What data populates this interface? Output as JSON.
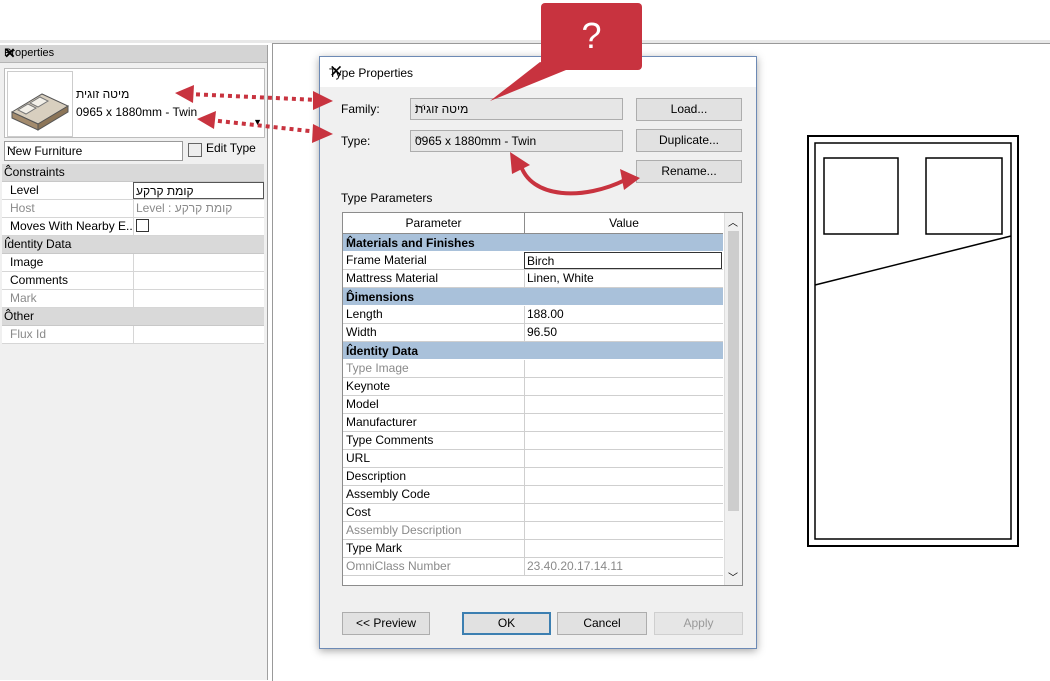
{
  "properties": {
    "title": "Properties",
    "family_name": "מיטה זוגית",
    "type_name": "0965 x 1880mm - Twin",
    "category": "New Furniture",
    "edit_type": "Edit Type",
    "groups": [
      {
        "name": "Constraints",
        "rows": [
          {
            "key": "Level",
            "value": "קומת קרקע",
            "editable": true
          },
          {
            "key": "Host",
            "value": "Level : קומת קרקע",
            "disabled": true
          },
          {
            "key": "Moves With Nearby E...",
            "value": "",
            "checkbox": true
          }
        ]
      },
      {
        "name": "Identity Data",
        "rows": [
          {
            "key": "Image",
            "value": ""
          },
          {
            "key": "Comments",
            "value": ""
          },
          {
            "key": "Mark",
            "value": "",
            "disabled": true
          }
        ]
      },
      {
        "name": "Other",
        "rows": [
          {
            "key": "Flux Id",
            "value": "",
            "disabled": true
          }
        ]
      }
    ]
  },
  "dialog": {
    "title": "Type Properties",
    "family_label": "Family:",
    "family_value": "מיטה זוגית",
    "type_label": "Type:",
    "type_value": "0965 x 1880mm - Twin",
    "load": "Load...",
    "duplicate": "Duplicate...",
    "rename": "Rename...",
    "type_parameters": "Type Parameters",
    "col_parameter": "Parameter",
    "col_value": "Value",
    "groups": [
      {
        "name": "Materials and Finishes",
        "rows": [
          {
            "key": "Frame Material",
            "value": "Birch",
            "editing": true
          },
          {
            "key": "Mattress Material",
            "value": "Linen, White"
          }
        ]
      },
      {
        "name": "Dimensions",
        "rows": [
          {
            "key": "Length",
            "value": "188.00"
          },
          {
            "key": "Width",
            "value": "96.50"
          }
        ]
      },
      {
        "name": "Identity Data",
        "rows": [
          {
            "key": "Type Image",
            "value": "",
            "disabled": true
          },
          {
            "key": "Keynote",
            "value": ""
          },
          {
            "key": "Model",
            "value": ""
          },
          {
            "key": "Manufacturer",
            "value": ""
          },
          {
            "key": "Type Comments",
            "value": ""
          },
          {
            "key": "URL",
            "value": ""
          },
          {
            "key": "Description",
            "value": ""
          },
          {
            "key": "Assembly Code",
            "value": ""
          },
          {
            "key": "Cost",
            "value": ""
          },
          {
            "key": "Assembly Description",
            "value": "",
            "disabled": true
          },
          {
            "key": "Type Mark",
            "value": ""
          },
          {
            "key": "OmniClass Number",
            "value": "23.40.20.17.14.11",
            "disabled": true
          }
        ]
      }
    ],
    "preview": "<< Preview",
    "ok": "OK",
    "cancel": "Cancel",
    "apply": "Apply"
  },
  "callout": {
    "text": "?",
    "color": "#c8333f"
  },
  "colors": {
    "group_header": "#a9c1da",
    "arrow": "#c8333f"
  }
}
